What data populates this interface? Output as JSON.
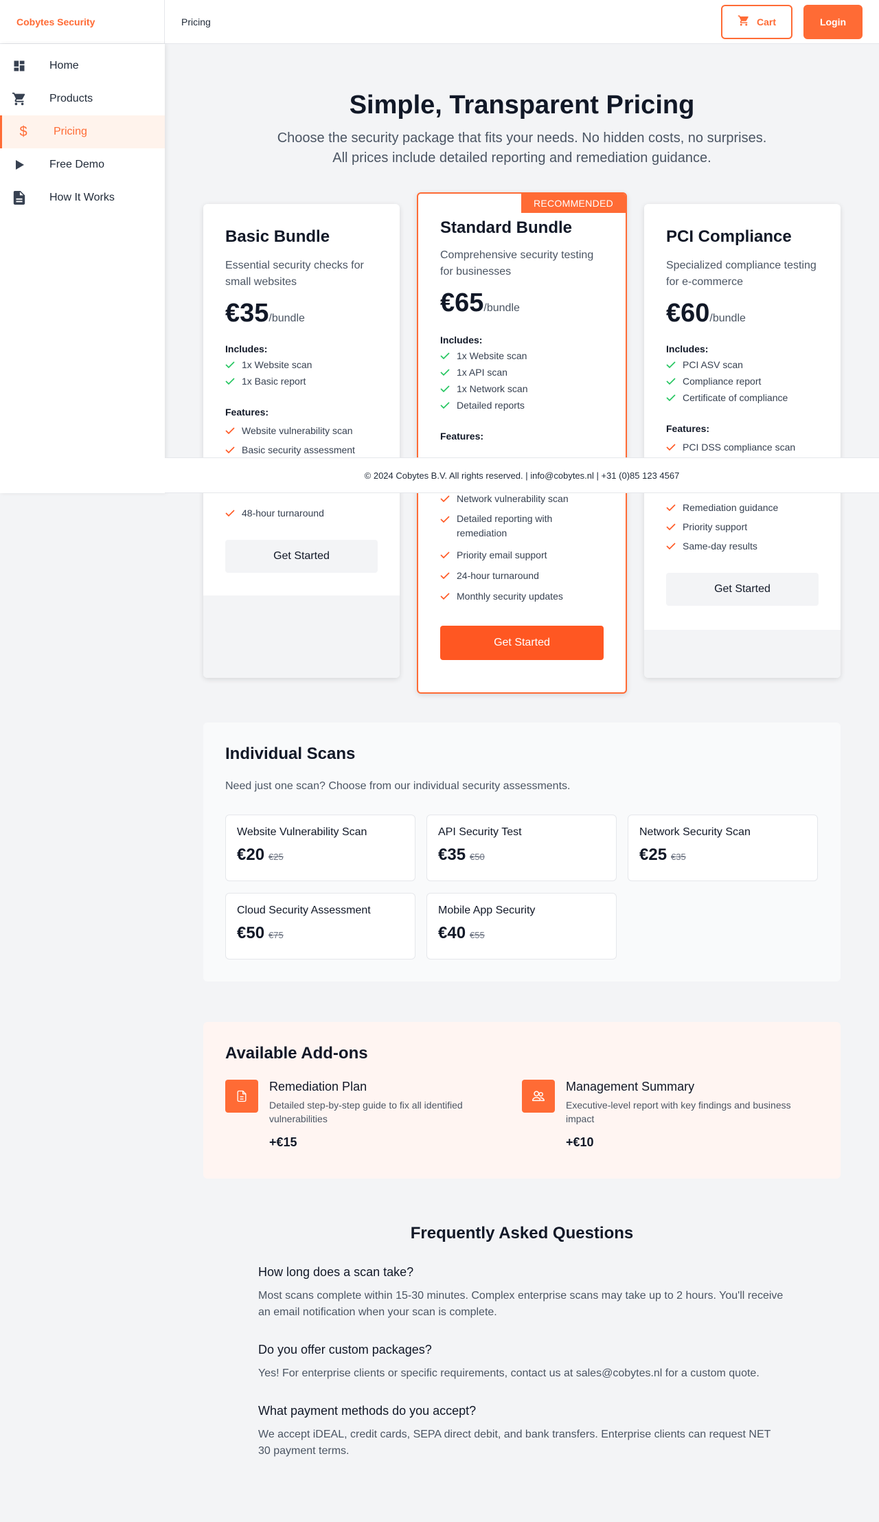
{
  "app": {
    "brand": "Cobytes Security"
  },
  "header": {
    "breadcrumb": "Pricing",
    "cart_label": "Cart",
    "login_label": "Login"
  },
  "colors": {
    "accent": "#ff6b35",
    "check_green": "#22c55e",
    "check_orange": "#ff5722"
  },
  "sidebar": {
    "items": [
      {
        "label": "Home",
        "icon": "dashboard-icon"
      },
      {
        "label": "Products",
        "icon": "cart-icon"
      },
      {
        "label": "Pricing",
        "icon": "dollar-icon",
        "active": true
      },
      {
        "label": "Free Demo",
        "icon": "play-icon"
      },
      {
        "label": "How It Works",
        "icon": "document-icon"
      }
    ]
  },
  "hero": {
    "title": "Simple, Transparent Pricing",
    "subtitle_line1": "Choose the security package that fits your needs. No hidden costs, no surprises.",
    "subtitle_line2": "All prices include detailed reporting and remediation guidance."
  },
  "plans": [
    {
      "name": "Basic Bundle",
      "desc": "Essential security checks for small websites",
      "price": "€35",
      "per": "/bundle",
      "includes_label": "Includes:",
      "includes": [
        "1x Website scan",
        "1x Basic report"
      ],
      "features_label": "Features:",
      "features": [
        "Website vulnerability scan",
        "Basic security assessment",
        "48-hour turnaround"
      ],
      "cta": "Get Started"
    },
    {
      "name": "Standard Bundle",
      "badge": "RECOMMENDED",
      "desc": "Comprehensive security testing for businesses",
      "price": "€65",
      "per": "/bundle",
      "includes_label": "Includes:",
      "includes": [
        "1x Website scan",
        "1x API scan",
        "1x Network scan",
        "Detailed reports"
      ],
      "features_label": "Features:",
      "features": [
        "Network vulnerability scan",
        "Detailed reporting with remediation",
        "Priority email support",
        "24-hour turnaround",
        "Monthly security updates"
      ],
      "cta": "Get Started"
    },
    {
      "name": "PCI Compliance",
      "desc": "Specialized compliance testing for e-commerce",
      "price": "€60",
      "per": "/bundle",
      "includes_label": "Includes:",
      "includes": [
        "PCI ASV scan",
        "Compliance report",
        "Certificate of compliance"
      ],
      "features_label": "Features:",
      "features": [
        "PCI DSS compliance scan",
        "Remediation guidance",
        "Priority support",
        "Same-day results"
      ],
      "cta": "Get Started"
    }
  ],
  "footer": {
    "text": "© 2024 Cobytes B.V. All rights reserved. | info@cobytes.nl | +31 (0)85 123 4567"
  },
  "scans": {
    "title": "Individual Scans",
    "subtitle": "Need just one scan? Choose from our individual security assessments.",
    "items": [
      {
        "name": "Website Vulnerability Scan",
        "price": "€20",
        "old": "€25"
      },
      {
        "name": "API Security Test",
        "price": "€35",
        "old": "€50"
      },
      {
        "name": "Network Security Scan",
        "price": "€25",
        "old": "€35"
      },
      {
        "name": "Cloud Security Assessment",
        "price": "€50",
        "old": "€75"
      },
      {
        "name": "Mobile App Security",
        "price": "€40",
        "old": "€55"
      }
    ]
  },
  "addons": {
    "title": "Available Add-ons",
    "items": [
      {
        "title": "Remediation Plan",
        "desc": "Detailed step-by-step guide to fix all identified vulnerabilities",
        "price": "+€15",
        "icon": "document-icon"
      },
      {
        "title": "Management Summary",
        "desc": "Executive-level report with key findings and business impact",
        "price": "+€10",
        "icon": "users-icon"
      }
    ]
  },
  "faq": {
    "title": "Frequently Asked Questions",
    "items": [
      {
        "q": "How long does a scan take?",
        "a": "Most scans complete within 15-30 minutes. Complex enterprise scans may take up to 2 hours. You'll receive an email notification when your scan is complete."
      },
      {
        "q": "Do you offer custom packages?",
        "a": "Yes! For enterprise clients or specific requirements, contact us at sales@cobytes.nl for a custom quote."
      },
      {
        "q": "What payment methods do you accept?",
        "a": "We accept iDEAL, credit cards, SEPA direct debit, and bank transfers. Enterprise clients can request NET 30 payment terms."
      }
    ]
  }
}
